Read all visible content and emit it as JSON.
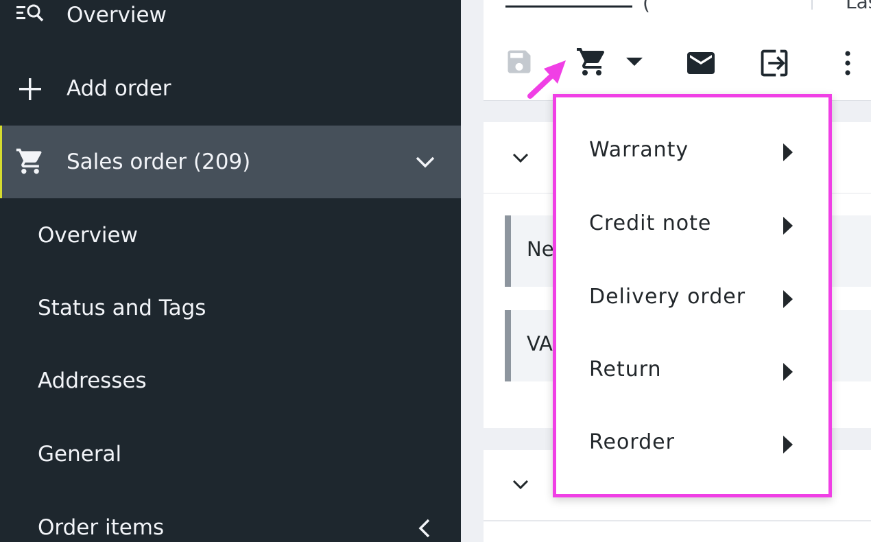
{
  "sidebar": {
    "top_items": [
      {
        "label": "Overview",
        "icon": "search-list-icon"
      },
      {
        "label": "Add order",
        "icon": "plus-icon"
      },
      {
        "label": "Sales order (209)",
        "icon": "cart-icon"
      }
    ],
    "sub_items": [
      {
        "label": "Overview"
      },
      {
        "label": "Status and Tags"
      },
      {
        "label": "Addresses"
      },
      {
        "label": "General"
      },
      {
        "label": "Order items"
      }
    ]
  },
  "topbar": {
    "paren_text": "(",
    "last_label": "Last"
  },
  "fields": [
    {
      "label": "Ne"
    },
    {
      "label": "VA"
    }
  ],
  "dropdown": {
    "items": [
      {
        "label": "Warranty"
      },
      {
        "label": "Credit note"
      },
      {
        "label": "Delivery order"
      },
      {
        "label": "Return"
      },
      {
        "label": "Reorder"
      }
    ]
  },
  "colors": {
    "sidebar_bg": "#1e272e",
    "sidebar_active_bg": "#46505a",
    "active_indicator": "#d6dc2f",
    "highlight": "#f03fe5",
    "main_bg": "#eef0f4"
  }
}
